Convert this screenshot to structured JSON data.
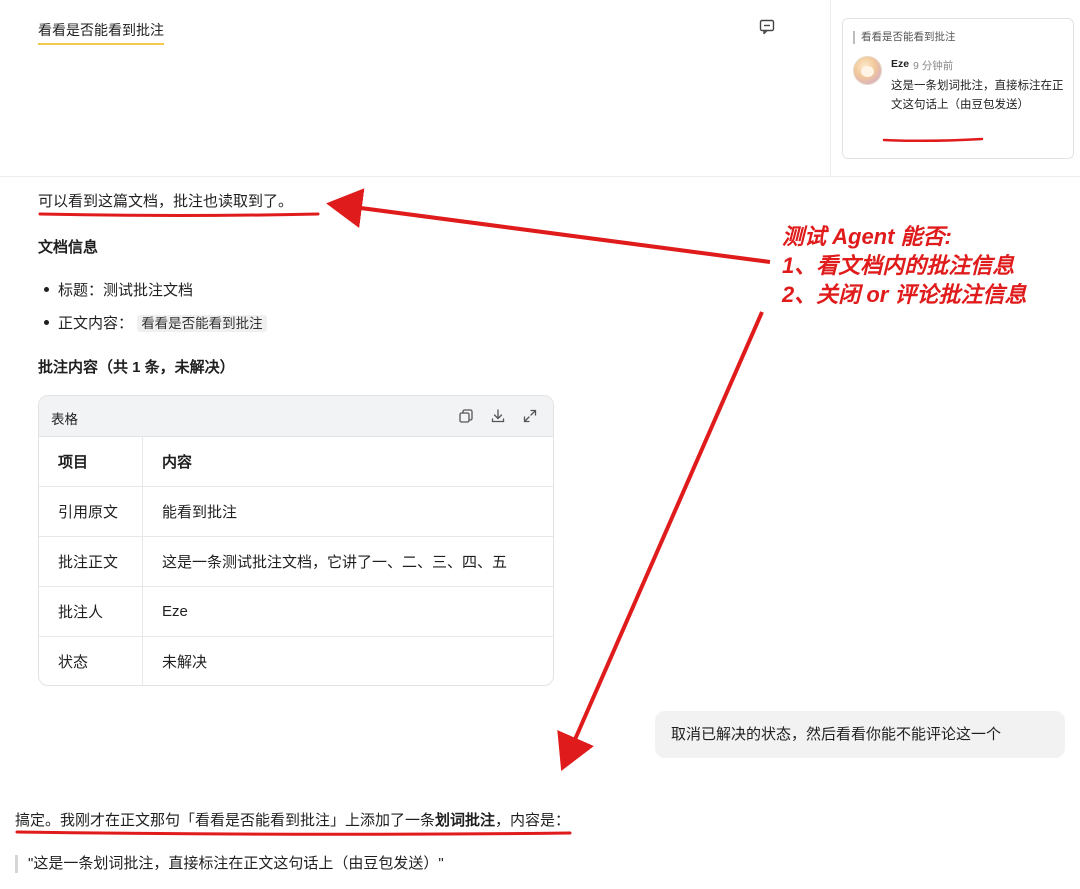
{
  "document": {
    "annotated_text": "看看是否能看到批注"
  },
  "comment": {
    "quote": "看看是否能看到批注",
    "author": "Eze",
    "time": "9 分钟前",
    "body": "这是一条划词批注，直接标注在正文这句话上（由豆包发送）"
  },
  "chat": {
    "intro": "可以看到这篇文档，批注也读取到了。",
    "docinfo_heading": "文档信息",
    "bullets": {
      "title_label": "标题：",
      "title_value": "测试批注文档",
      "body_label": "正文内容：",
      "body_value": "看看是否能看到批注"
    },
    "comments_heading": "批注内容（共 1 条，未解决）",
    "table": {
      "title": "表格",
      "header": [
        "项目",
        "内容"
      ],
      "rows": [
        [
          "引用原文",
          "能看到批注"
        ],
        [
          "批注正文",
          "这是一条测试批注文档，它讲了一、二、三、四、五"
        ],
        [
          "批注人",
          "Eze"
        ],
        [
          "状态",
          "未解决"
        ]
      ]
    },
    "user_message": "取消已解决的状态，然后看看你能不能评论这一个",
    "answer": {
      "prefix": "搞定。我刚才在正文那句「看看是否能看到批注」上添加了一条",
      "bold": "划词批注",
      "suffix": "，内容是：",
      "quote": "\"这是一条划词批注，直接标注在正文这句话上（由豆包发送）\""
    }
  },
  "annotation": {
    "lines": [
      "测试 Agent 能否:",
      "1、看文档内的批注信息",
      "2、关闭 or 评论批注信息"
    ],
    "color": "#e01b1b"
  },
  "colors": {
    "highlight": "#f2c94c",
    "bubble": "#f2f2f2",
    "table_head": "#f2f3f5"
  }
}
